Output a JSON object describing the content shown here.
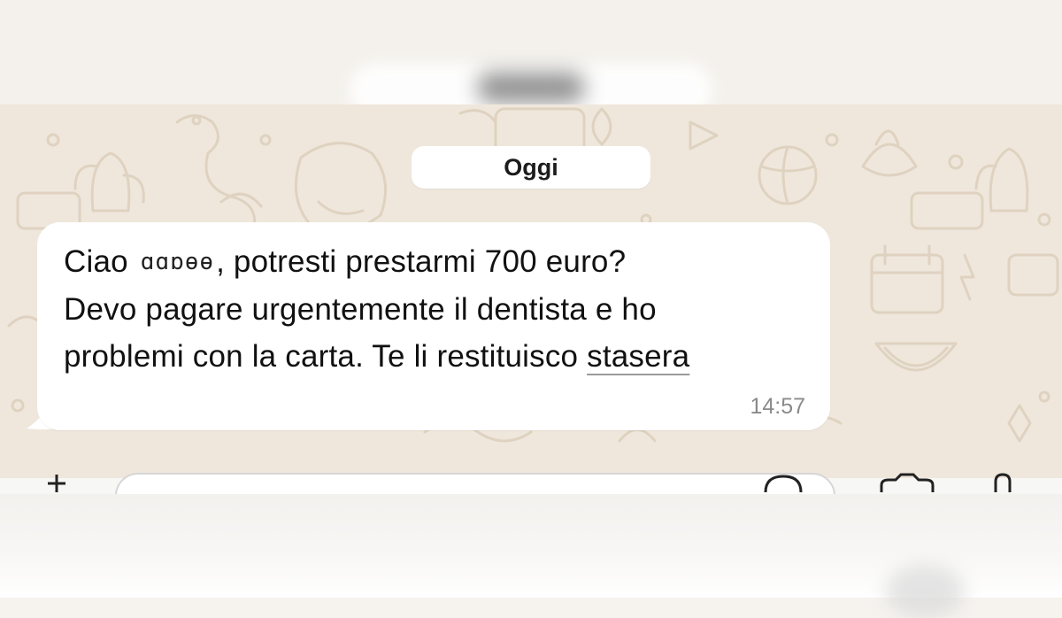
{
  "date_separator": "Oggi",
  "message": {
    "greeting": "Ciao",
    "redacted_name": "ɑɑɒɵɵ",
    "line1_rest": ", potresti prestarmi 700 euro?",
    "line2": "Devo pagare urgentemente il dentista e ho",
    "line3_start": "problemi con la carta. Te li restituisco ",
    "line3_link": "stasera",
    "time": "14:57"
  },
  "input_bar": {
    "left_icon": "plus-icon",
    "right_icons": [
      "sticker-icon",
      "camera-icon",
      "mic-icon"
    ]
  }
}
